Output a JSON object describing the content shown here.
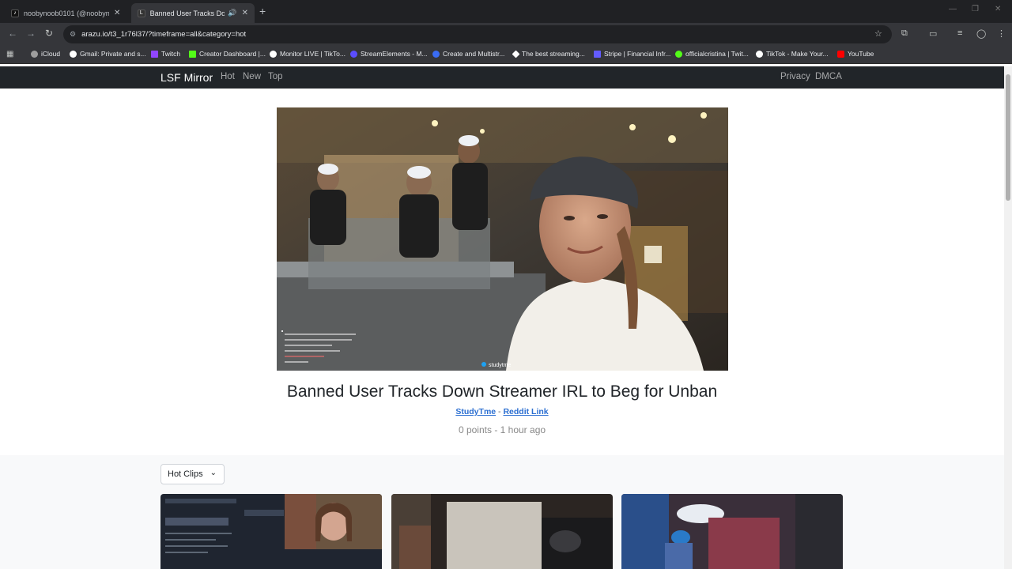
{
  "browser": {
    "tabs": [
      {
        "title": "noobynoob0101 (@noobynoob",
        "active": false
      },
      {
        "title": "Banned User Tracks Down S",
        "active": true
      }
    ],
    "url": "arazu.io/t3_1r76l37/?timeframe=all&category=hot",
    "bookmarks": [
      {
        "label": "iCloud",
        "color": "#9e9e9e"
      },
      {
        "label": "Gmail: Private and s...",
        "color": "#ffffff"
      },
      {
        "label": "Twitch",
        "color": "#9146ff"
      },
      {
        "label": "Creator Dashboard |...",
        "color": "#53fc18"
      },
      {
        "label": "Monitor LIVE | TikTo...",
        "color": "#ffffff"
      },
      {
        "label": "StreamElements - M...",
        "color": "#5b4dff"
      },
      {
        "label": "Create and Multistr...",
        "color": "#3a6cf4"
      },
      {
        "label": "The best streaming...",
        "color": "#ffffff"
      },
      {
        "label": "Stripe | Financial Infr...",
        "color": "#635bff"
      },
      {
        "label": "officialcristina | Twit...",
        "color": "#53fc18"
      },
      {
        "label": "TikTok - Make Your...",
        "color": "#ffffff"
      },
      {
        "label": "YouTube",
        "color": "#ff0000"
      }
    ]
  },
  "site": {
    "brand": "LSF Mirror",
    "nav": [
      "Hot",
      "New",
      "Top"
    ],
    "nav_right": [
      "Privacy",
      "DMCA"
    ]
  },
  "post": {
    "title": "Banned User Tracks Down Streamer IRL to Beg for Unban",
    "author": "StudyTme",
    "separator": "-",
    "reddit_link": "Reddit Link",
    "points": "0 points",
    "stats_separator": "-",
    "age": "1 hour ago",
    "video_watermark": "studytme"
  },
  "filter": {
    "selected": "Hot Clips"
  }
}
